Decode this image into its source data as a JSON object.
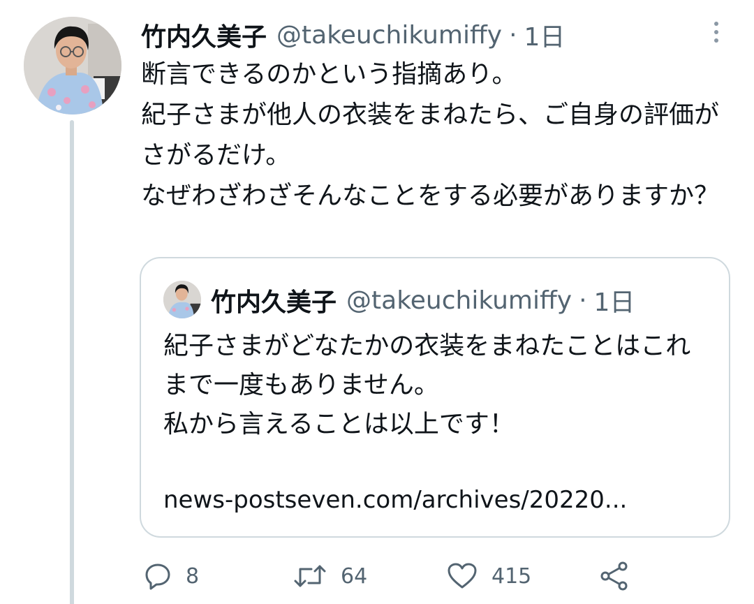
{
  "tweet": {
    "author_name": "竹内久美子",
    "handle": "@takeuchikumiffy",
    "separator": "·",
    "time": "1日",
    "text": "断言できるのかという指摘あり。\n紀子さまが他人の衣装をまねたら、ご自身の評価がさがるだけ。\nなぜわざわざそんなことをする必要がありますか？"
  },
  "quoted_tweet": {
    "author_name": "竹内久美子",
    "handle": "@takeuchikumiffy",
    "separator": "·",
    "time": "1日",
    "text": "紀子さまがどなたかの衣装をまねたことはこれまで一度もありません。\n私から言えることは以上です！",
    "link": "news-postseven.com/archives/20220..."
  },
  "actions": {
    "reply_count": "8",
    "retweet_count": "64",
    "like_count": "415"
  },
  "icons": {
    "reply": "reply-icon",
    "retweet": "retweet-icon",
    "like": "heart-icon",
    "share": "share-icon",
    "more": "more-vertical-icon"
  },
  "colors": {
    "text": "#0f1419",
    "secondary": "#536471",
    "border": "#cfd9de"
  }
}
